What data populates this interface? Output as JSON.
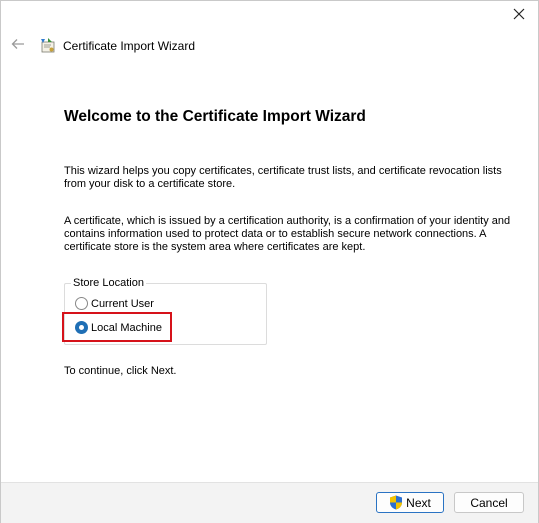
{
  "window": {
    "title": "Certificate Import Wizard",
    "close_glyph": "✕"
  },
  "main": {
    "heading": "Welcome to the Certificate Import Wizard",
    "paragraph1": "This wizard helps you copy certificates, certificate trust lists, and certificate revocation lists from your disk to a certificate store.",
    "paragraph2": "A certificate, which is issued by a certification authority, is a confirmation of your identity and contains information used to protect data or to establish secure network connections. A certificate store is the system area where certificates are kept.",
    "store_location": {
      "title": "Store Location",
      "options": [
        {
          "label": "Current User",
          "selected": false
        },
        {
          "label": "Local Machine",
          "selected": true
        }
      ]
    },
    "continue_text": "To continue, click Next."
  },
  "footer": {
    "next_label": "Next",
    "cancel_label": "Cancel"
  },
  "colors": {
    "accent": "#1f6fb5",
    "highlight": "#d6121a"
  },
  "icons": {
    "back": "back-arrow-icon",
    "wizard": "certificate-wizard-icon",
    "close": "close-icon",
    "shield": "uac-shield-icon"
  }
}
